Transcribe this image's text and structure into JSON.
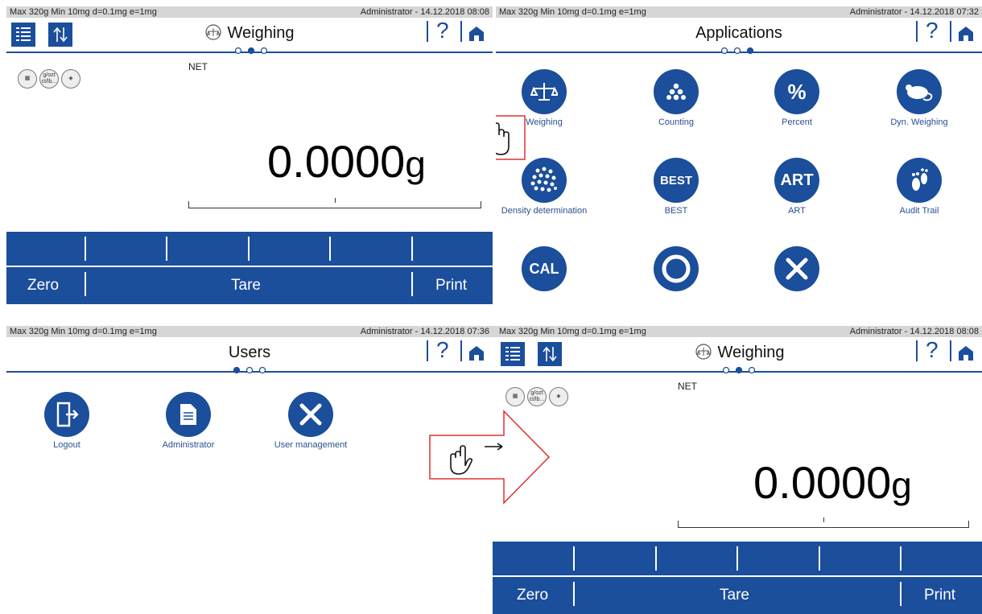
{
  "status": {
    "left": "Max 320g  Min 10mg  d=0.1mg  e=1mg",
    "p1_right": "Administrator  -  14.12.2018 08:08",
    "p2_right": "Administrator  -  14.12.2018 07:32",
    "p3_right": "Administrator  -  14.12.2018 07:36",
    "p4_right": "Administrator  -  14.12.2018 08:08"
  },
  "weighing": {
    "title": "Weighing",
    "net_label": "NET",
    "value": "0.0000",
    "unit": "g",
    "mini_icons": [
      "chart-icon",
      "g/ozt ct/lb...",
      "tag-icon"
    ],
    "zero": "Zero",
    "tare": "Tare",
    "print": "Print"
  },
  "applications": {
    "title": "Applications",
    "items": [
      {
        "label": "Weighing",
        "icon": "scale-icon"
      },
      {
        "label": "Counting",
        "icon": "dots-icon"
      },
      {
        "label": "Percent",
        "icon": "%"
      },
      {
        "label": "Dyn. Weighing",
        "icon": "mouse-icon"
      },
      {
        "label": "Density determination",
        "icon": "bubbles-icon"
      },
      {
        "label": "BEST",
        "icon": "BEST"
      },
      {
        "label": "ART",
        "icon": "ART"
      },
      {
        "label": "Audit Trail",
        "icon": "footprint-icon"
      },
      {
        "label": "",
        "icon": "CAL"
      },
      {
        "label": "",
        "icon": "ring-icon"
      },
      {
        "label": "",
        "icon": "tools-icon"
      }
    ]
  },
  "users": {
    "title": "Users",
    "items": [
      {
        "label": "Logout",
        "icon": "door-icon"
      },
      {
        "label": "Administrator",
        "icon": "document-icon"
      },
      {
        "label": "User management",
        "icon": "tools-icon"
      }
    ]
  },
  "help_glyph": "?",
  "colors": {
    "brand": "#1b4e9b",
    "arrow": "#e03030"
  }
}
